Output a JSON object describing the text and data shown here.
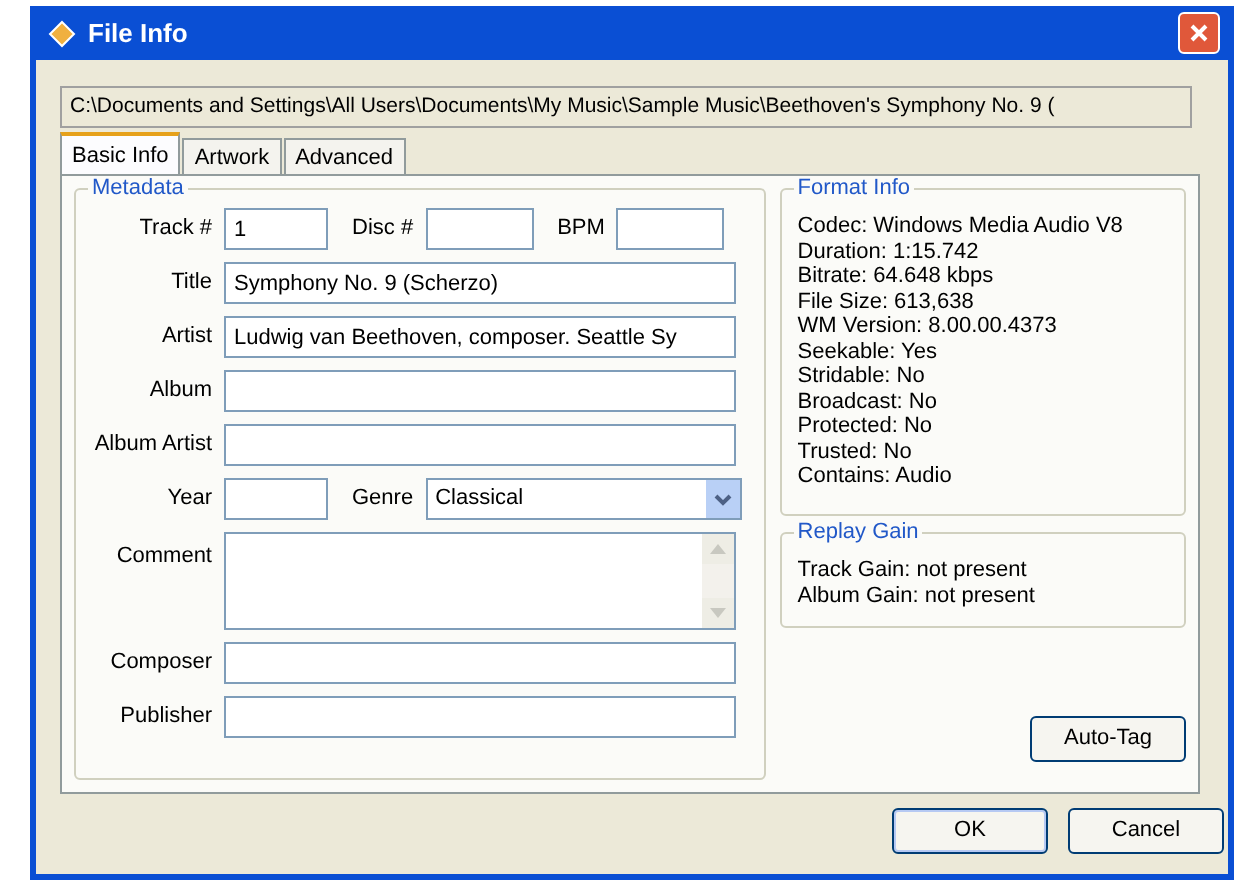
{
  "window": {
    "title": "File Info"
  },
  "path": "C:\\Documents and Settings\\All Users\\Documents\\My Music\\Sample Music\\Beethoven's Symphony No. 9 (",
  "tabs": [
    {
      "label": "Basic Info",
      "selected": true
    },
    {
      "label": "Artwork",
      "selected": false
    },
    {
      "label": "Advanced",
      "selected": false
    }
  ],
  "metadata": {
    "title": "Metadata",
    "rows": [
      {
        "fields": [
          {
            "kind": "short",
            "label": "Track #",
            "value": "1"
          },
          {
            "kind": "short",
            "label": "Disc #"
          },
          {
            "kind": "short",
            "label": "BPM"
          }
        ]
      },
      {
        "fields": [
          {
            "kind": "text",
            "label": "Title",
            "value": "Symphony No. 9 (Scherzo)"
          }
        ]
      },
      {
        "fields": [
          {
            "kind": "text",
            "label": "Artist",
            "value": "Ludwig van Beethoven, composer. Seattle Sy"
          }
        ]
      },
      {
        "fields": [
          {
            "kind": "text",
            "label": "Album"
          }
        ]
      },
      {
        "fields": [
          {
            "kind": "text",
            "label": "Album Artist"
          }
        ]
      },
      {
        "fields": [
          {
            "kind": "short",
            "label": "Year"
          },
          {
            "kind": "dropdown",
            "label": "Genre",
            "value": "Classical"
          }
        ]
      },
      {
        "fields": [
          {
            "kind": "multiline",
            "label": "Comment"
          }
        ]
      },
      {
        "fields": [
          {
            "kind": "text",
            "label": "Composer"
          }
        ]
      },
      {
        "fields": [
          {
            "kind": "text",
            "label": "Publisher"
          }
        ]
      }
    ]
  },
  "format_info": {
    "title": "Format Info",
    "lines": [
      "Codec: Windows Media Audio V8",
      "Duration: 1:15.742",
      "Bitrate: 64.648 kbps",
      "File Size: 613,638",
      "WM Version: 8.00.00.4373",
      "Seekable: Yes",
      "Stridable: No",
      "Broadcast: No",
      "Protected: No",
      "Trusted: No",
      "Contains: Audio"
    ]
  },
  "replay_gain": {
    "title": "Replay Gain",
    "lines": [
      "Track Gain: not present",
      "Album Gain: not present"
    ]
  },
  "auto_tag_button": "Auto-Tag",
  "buttons": [
    "OK",
    "Cancel"
  ]
}
